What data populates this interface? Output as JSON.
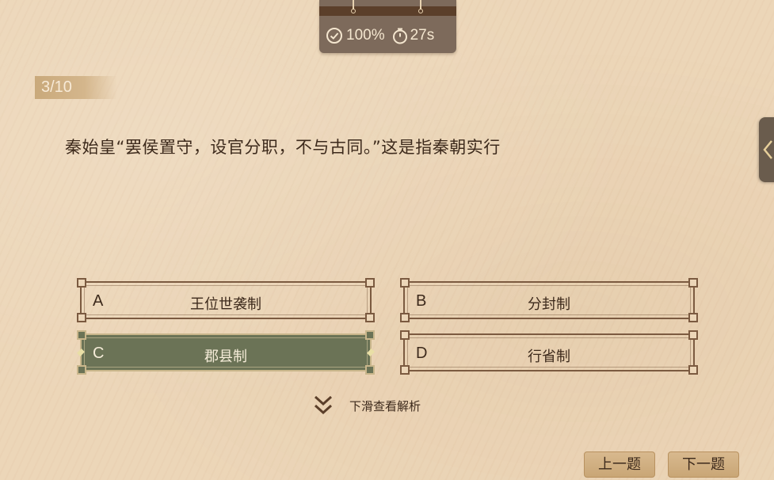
{
  "hud": {
    "accuracy": "100%",
    "timer": "27s"
  },
  "progress": "3/10",
  "question": "秦始皇“罢侯置守，设官分职，不与古同。”这是指秦朝实行",
  "options": [
    {
      "letter": "A",
      "text": "王位世袭制",
      "selected": false
    },
    {
      "letter": "B",
      "text": "分封制",
      "selected": false
    },
    {
      "letter": "C",
      "text": "郡县制",
      "selected": true
    },
    {
      "letter": "D",
      "text": "行省制",
      "selected": false
    }
  ],
  "scroll_hint": "下滑查看解析",
  "nav": {
    "prev_label": "上一题",
    "next_label": "下一题"
  },
  "colors": {
    "selected_fill": "#6b7356",
    "frame": "#7b5a40",
    "background": "#ecd6b8"
  }
}
